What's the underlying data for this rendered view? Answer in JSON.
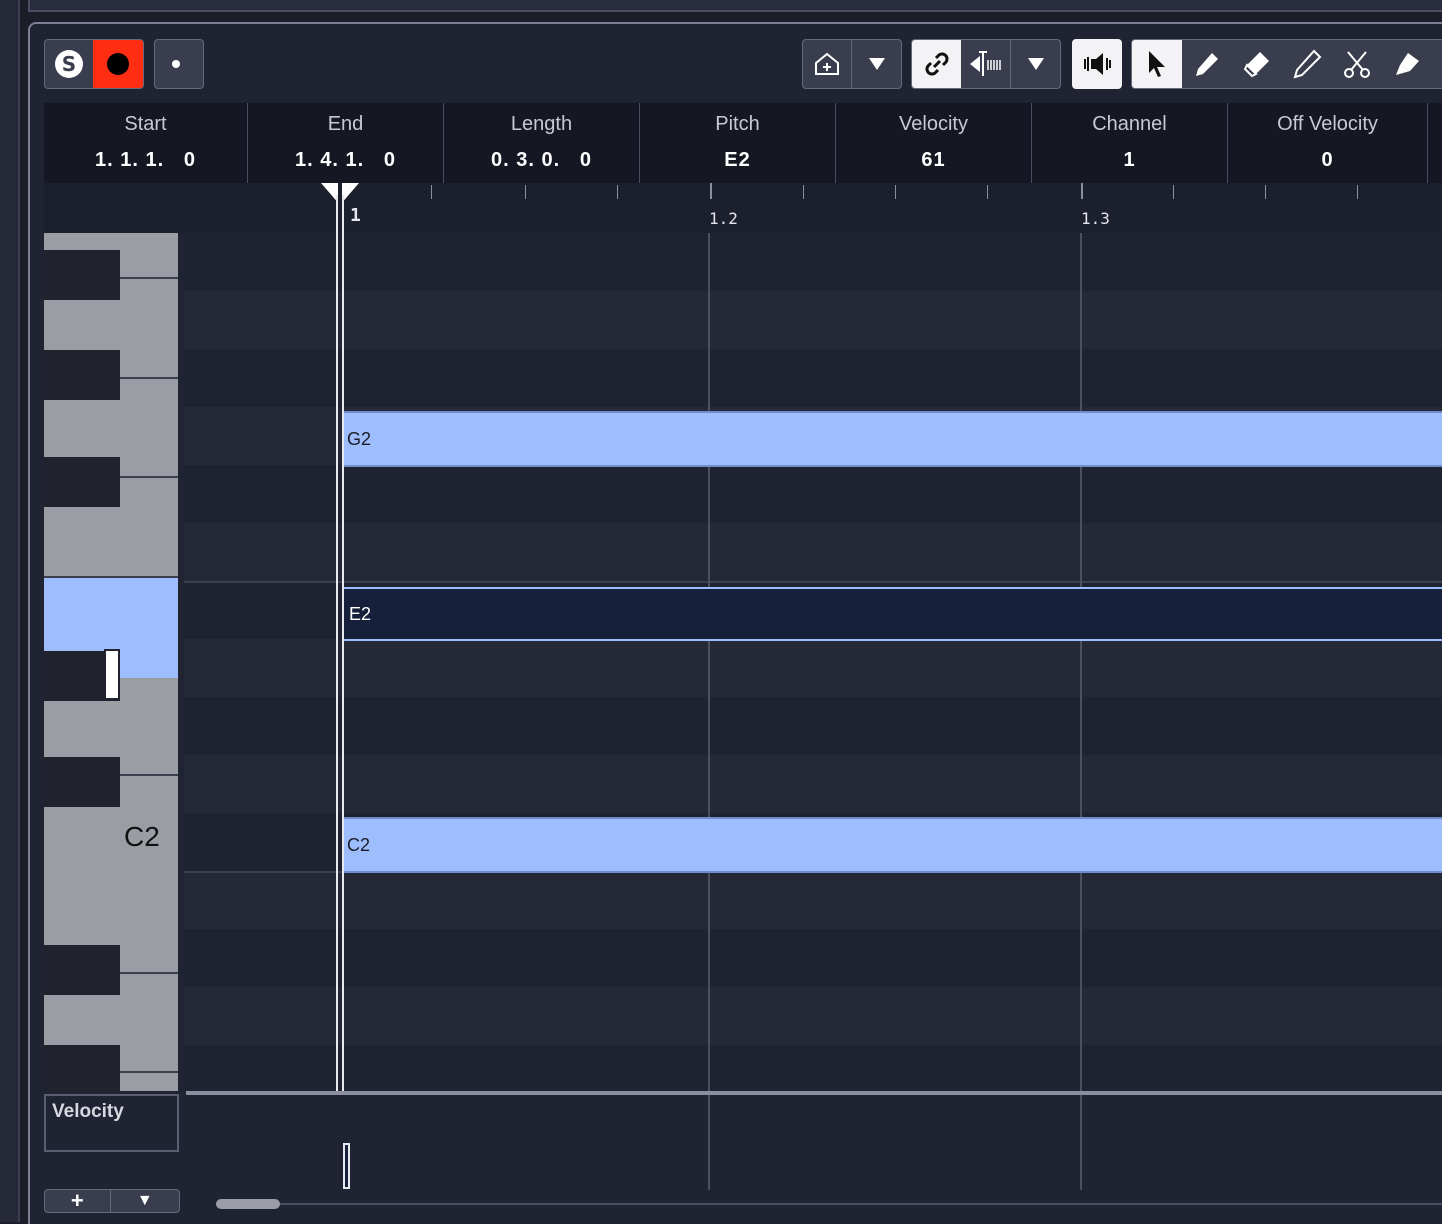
{
  "colors": {
    "accent": "#9dbdfc",
    "record": "#ff2d12",
    "selected_note": "#16203a",
    "background": "#202332"
  },
  "toolbar": {
    "solo_icon": "solo-s-icon",
    "record_icon": "record-dot-icon",
    "monitor_icon": "monitor-icon",
    "tools": [
      "object-selection-icon",
      "draw-icon",
      "erase-icon",
      "trim-icon",
      "split-icon",
      "glue-icon"
    ]
  },
  "info_line": [
    {
      "label": "Start",
      "value": "1. 1. 1.   0"
    },
    {
      "label": "End",
      "value": "1. 4. 1.   0"
    },
    {
      "label": "Length",
      "value": "0. 3. 0.   0"
    },
    {
      "label": "Pitch",
      "value": "E2"
    },
    {
      "label": "Velocity",
      "value": "61"
    },
    {
      "label": "Channel",
      "value": "1"
    },
    {
      "label": "Off Velocity",
      "value": "0"
    }
  ],
  "ruler": {
    "marks": [
      "1",
      "1.2",
      "1.3"
    ]
  },
  "piano": {
    "c_label": "C2"
  },
  "notes": [
    {
      "pitch": "G2",
      "selected": false
    },
    {
      "pitch": "E2",
      "selected": true
    },
    {
      "pitch": "C2",
      "selected": false
    }
  ],
  "controller_lane": {
    "label": "Velocity",
    "add_label": "+",
    "menu_label": "▼"
  }
}
